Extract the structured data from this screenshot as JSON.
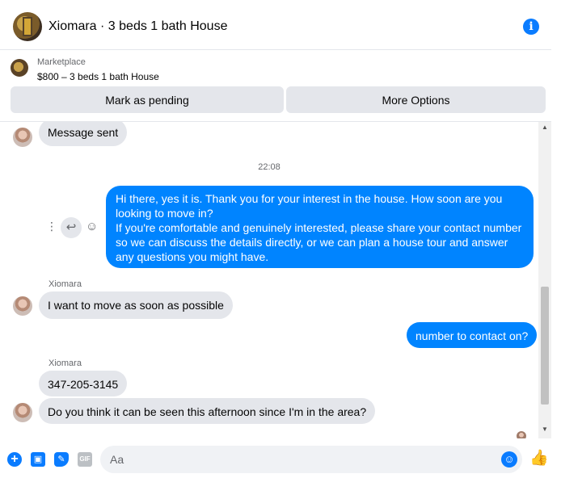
{
  "header": {
    "title": "Xiomara · 3 beds 1 bath House",
    "info_icon": "i"
  },
  "listing": {
    "label": "Marketplace",
    "price_title": "$800 – 3 beds 1 bath House"
  },
  "actions": {
    "pending_label": "Mark as pending",
    "more_label": "More Options"
  },
  "messages": [
    {
      "from": "Xiomara",
      "direction": "in",
      "text": "Message sent"
    },
    {
      "timestamp": "22:08"
    },
    {
      "from": "me",
      "direction": "out",
      "text": "Hi there, yes it is. Thank you for your interest in the house. How soon are you looking to move in?\nIf you're comfortable and genuinely interested, please share your contact number so we can discuss the details directly, or we can plan a house tour and answer any questions you might have."
    },
    {
      "from": "Xiomara",
      "direction": "in",
      "sender_label": "Xiomara",
      "text": "I want to move as soon as possible"
    },
    {
      "from": "me",
      "direction": "out",
      "text": "number to contact on?"
    },
    {
      "from": "Xiomara",
      "direction": "in",
      "sender_label": "Xiomara",
      "text": "347-205-3145"
    },
    {
      "from": "Xiomara",
      "direction": "in",
      "text": "Do you think it can be seen this afternoon since I'm in the area?"
    }
  ],
  "message_tools": {
    "more_icon": "⋮",
    "reply_icon": "↩",
    "react_icon": "☺"
  },
  "scrollbar": {
    "up_icon": "▲",
    "down_icon": "▼"
  },
  "composer": {
    "placeholder": "Aa",
    "plus_icon": "+",
    "photo_icon": "▣",
    "sticker_icon": "✎",
    "gif_icon": "GIF",
    "emoji_icon": "☺",
    "like_icon": "👍"
  }
}
